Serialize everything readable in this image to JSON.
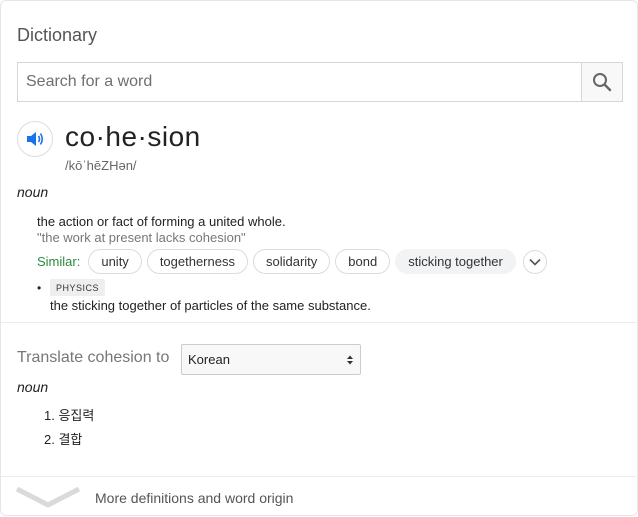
{
  "section_title": "Dictionary",
  "search": {
    "placeholder": "Search for a word",
    "value": "",
    "button_icon": "search-icon"
  },
  "entry": {
    "headword": "co·he·sion",
    "phonetic": "/kōˈhēZHən/",
    "pronounce_icon": "speaker-icon",
    "part_of_speech": "noun",
    "definitions": [
      {
        "text": "the action or fact of forming a united whole.",
        "example": "\"the work at present lacks cohesion\"",
        "similar_label": "Similar:",
        "similar": [
          "unity",
          "togetherness",
          "solidarity",
          "bond",
          "sticking together"
        ],
        "more_icon": "chevron-down-icon"
      },
      {
        "bullet": "•",
        "subject": "PHYSICS",
        "text": "the sticking together of particles of the same substance."
      }
    ]
  },
  "translate": {
    "label": "Translate cohesion to",
    "language": "Korean",
    "part_of_speech": "noun",
    "items": [
      "1. 응집력",
      "2. 결합"
    ]
  },
  "footer": {
    "text": "More definitions and word origin",
    "icon": "chevron-down-icon"
  },
  "colors": {
    "similar_label": "#2b8a3e",
    "speaker_icon": "#1a73e8",
    "chip_filled_bg": "#f1f3f4"
  }
}
